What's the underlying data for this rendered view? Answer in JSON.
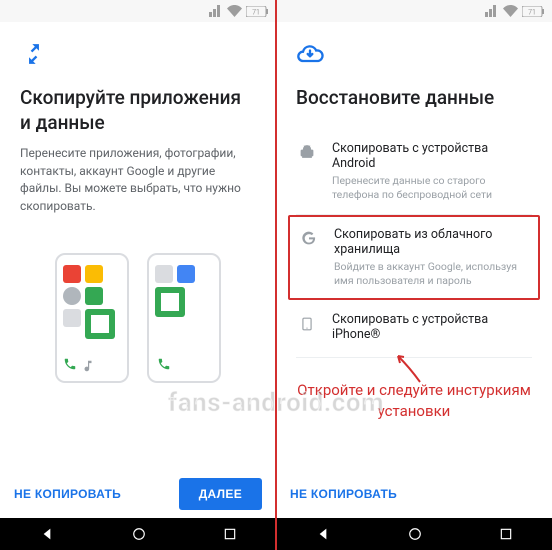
{
  "left": {
    "title": "Скопируйте приложения и данные",
    "subtitle": "Перенесите приложения, фотографии, контакты, аккаунт Google и другие файлы. Вы можете выбрать, что нужно скопировать.",
    "skip": "НЕ КОПИРОВАТЬ",
    "next": "ДАЛЕЕ"
  },
  "right": {
    "title": "Восстановите данные",
    "options": [
      {
        "title": "Скопировать с устройства Android",
        "sub": "Перенесите данные со старого телефона по беспроводной сети"
      },
      {
        "title": "Скопировать из облачного хранилища",
        "sub": "Войдите в аккаунт Google, используя имя пользователя и пароль"
      },
      {
        "title": "Скопировать с устройства iPhone®",
        "sub": ""
      }
    ],
    "skip": "НЕ КОПИРОВАТЬ",
    "annotation": "Откройте и следуйте инстуркиям установки"
  },
  "watermark": "fans-android.com",
  "battery": "71"
}
